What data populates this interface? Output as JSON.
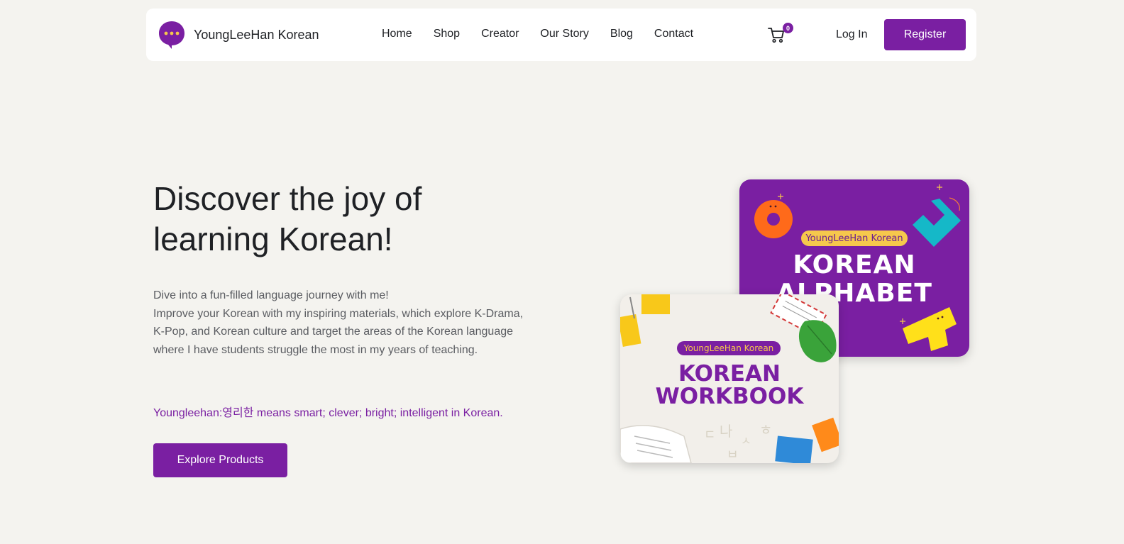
{
  "brand": {
    "name": "YoungLeeHan Korean",
    "accent": "#7a1fa2"
  },
  "nav": {
    "links": [
      "Home",
      "Shop",
      "Creator",
      "Our Story",
      "Blog",
      "Contact"
    ],
    "cart_count": "0",
    "login_label": "Log In",
    "register_label": "Register"
  },
  "hero": {
    "title_line1": "Discover the joy of",
    "title_line2": "learning Korean!",
    "desc_line1": "Dive into a fun-filled language journey with me!",
    "desc_line2": "Improve your Korean with my inspiring materials, which explore K-Drama, K-Pop, and Korean culture and target the areas of the Korean language where I have students struggle the most in my years of teaching.",
    "note": "Youngleehan:영리한 means smart; clever; bright; intelligent in Korean.",
    "cta_label": "Explore Products"
  },
  "products": [
    {
      "tag": "YoungLeeHan Korean",
      "title_line1": "KOREAN",
      "title_line2": "ALPHABET",
      "bg": "#7a1fa2"
    },
    {
      "tag": "YoungLeeHan Korean",
      "title_line1": "KOREAN",
      "title_line2": "WORKBOOK",
      "bg": "#f2efea"
    }
  ]
}
